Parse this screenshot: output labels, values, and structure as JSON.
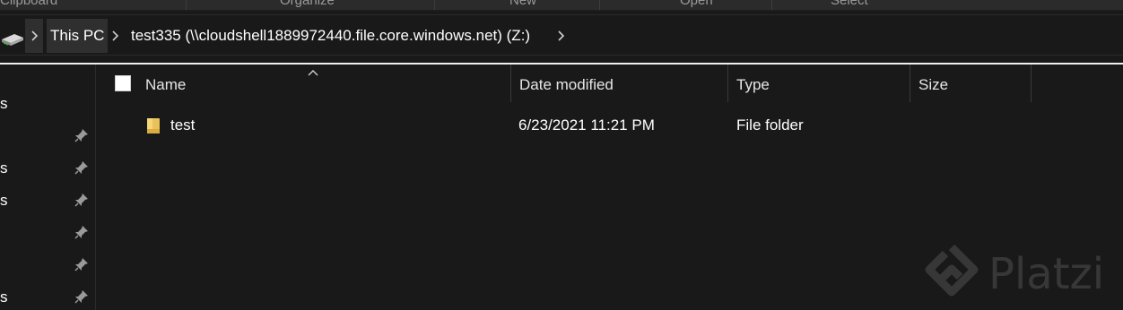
{
  "ribbon": {
    "groups": [
      "Clipboard",
      "Organize",
      "New",
      "Open",
      "Select"
    ]
  },
  "address_bar": {
    "icon": "network-drive-icon",
    "crumbs": [
      "This PC",
      "test335 (\\\\cloudshell1889972440.file.core.windows.net) (Z:)"
    ]
  },
  "nav_pane": {
    "items": [
      {
        "text": "s",
        "pinned": false
      },
      {
        "text": "",
        "pinned": true
      },
      {
        "text": "s",
        "pinned": true
      },
      {
        "text": "s",
        "pinned": true
      },
      {
        "text": "",
        "pinned": true
      },
      {
        "text": "",
        "pinned": true
      },
      {
        "text": "s",
        "pinned": true
      }
    ]
  },
  "columns": {
    "name": "Name",
    "date_modified": "Date modified",
    "type": "Type",
    "size": "Size",
    "sorted_by": "Name"
  },
  "files": [
    {
      "name": "test",
      "date_modified": "6/23/2021 11:21 PM",
      "type": "File folder",
      "size": "",
      "icon": "folder-icon"
    }
  ],
  "watermark": {
    "text": "Platzi",
    "icon": "platzi-logo-icon"
  },
  "colors": {
    "background": "#191919",
    "folder": "#e8c25a",
    "text": "#ffffff"
  }
}
